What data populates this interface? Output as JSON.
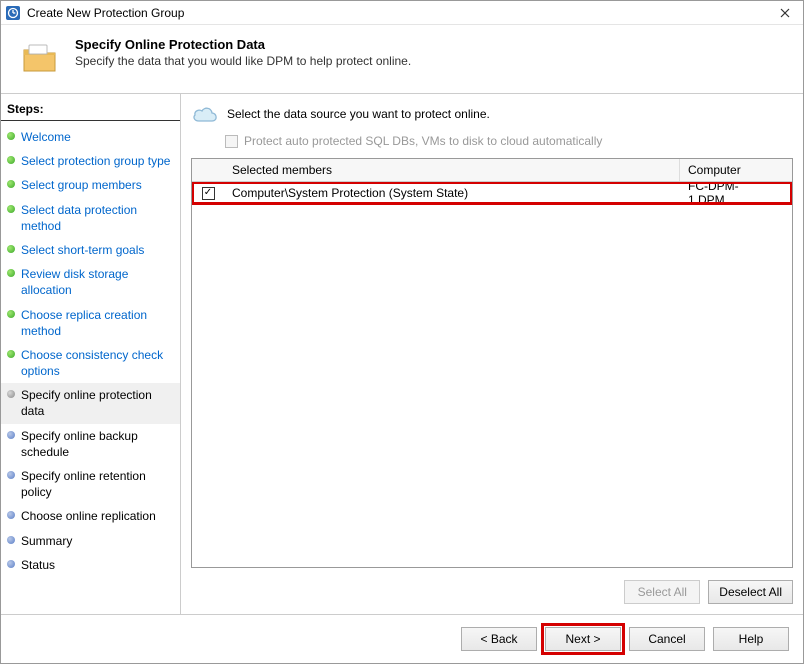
{
  "window": {
    "title": "Create New Protection Group"
  },
  "header": {
    "title": "Specify Online Protection Data",
    "subtitle": "Specify the data that you would like DPM to help protect online."
  },
  "steps": {
    "heading": "Steps:",
    "items": [
      {
        "label": "Welcome",
        "state": "done"
      },
      {
        "label": "Select protection group type",
        "state": "done"
      },
      {
        "label": "Select group members",
        "state": "done"
      },
      {
        "label": "Select data protection method",
        "state": "done"
      },
      {
        "label": "Select short-term goals",
        "state": "done"
      },
      {
        "label": "Review disk storage allocation",
        "state": "done"
      },
      {
        "label": "Choose replica creation method",
        "state": "done"
      },
      {
        "label": "Choose consistency check options",
        "state": "done"
      },
      {
        "label": "Specify online protection data",
        "state": "current"
      },
      {
        "label": "Specify online backup schedule",
        "state": "pending"
      },
      {
        "label": "Specify online retention policy",
        "state": "pending"
      },
      {
        "label": "Choose online replication",
        "state": "pending"
      },
      {
        "label": "Summary",
        "state": "pending"
      },
      {
        "label": "Status",
        "state": "pending"
      }
    ]
  },
  "main": {
    "instruction": "Select the data source you want to protect online.",
    "auto_protect_label": "Protect auto protected SQL DBs, VMs to disk to cloud automatically",
    "table": {
      "col_member": "Selected members",
      "col_computer": "Computer",
      "rows": [
        {
          "checked": true,
          "member": "Computer\\System Protection (System State)",
          "computer": "FC-DPM-1.DPM..."
        }
      ]
    },
    "buttons": {
      "select_all": "Select All",
      "deselect_all": "Deselect All"
    }
  },
  "footer": {
    "back": "< Back",
    "next": "Next >",
    "cancel": "Cancel",
    "help": "Help"
  }
}
